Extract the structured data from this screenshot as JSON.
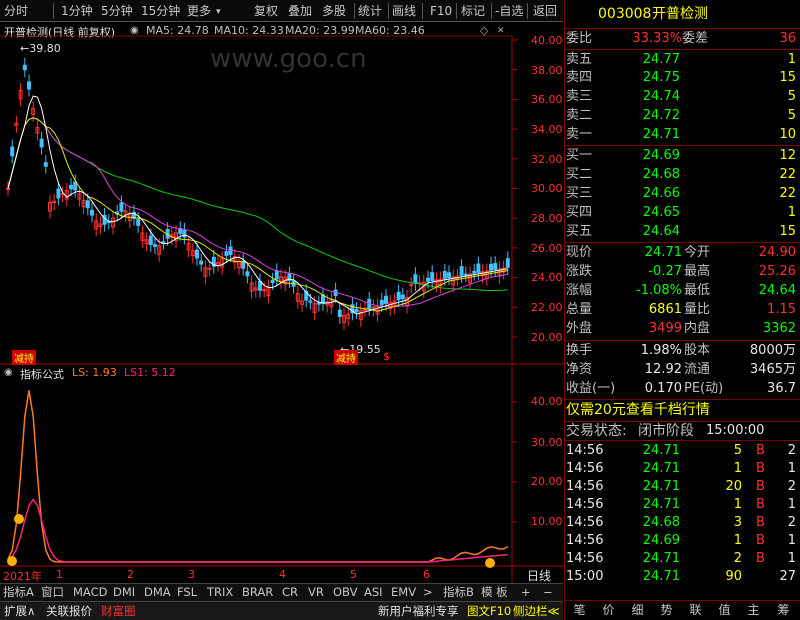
{
  "toolbar": {
    "periods": [
      "分时",
      "1分钟",
      "5分钟",
      "15分钟",
      "更多"
    ],
    "actions": [
      "复权",
      "叠加",
      "多股",
      "统计",
      "画线",
      "F10",
      "标记",
      "-自选",
      "返回"
    ]
  },
  "main": {
    "title": "开普检测(日线 前复权)",
    "ma": [
      {
        "label": "MA5: 24.78",
        "color": "#ffffff"
      },
      {
        "label": "MA10: 24.33",
        "color": "#ffff00"
      },
      {
        "label": "MA20: 23.99",
        "color": "#ff40ff"
      },
      {
        "label": "MA60: 23.46",
        "color": "#00ff00"
      }
    ],
    "y_ticks": [
      "40.00",
      "38.00",
      "36.00",
      "34.00",
      "32.00",
      "30.00",
      "28.00",
      "26.00",
      "24.00",
      "22.00",
      "20.00"
    ],
    "high_label": "39.80",
    "low_label": "19.55",
    "badges": [
      "减持",
      "减持",
      "$"
    ],
    "watermark": "www.goo.cn"
  },
  "indicator": {
    "name": "指标公式",
    "ls": "LS: 1.93",
    "ls1": "LS1: 5.12",
    "y_ticks": [
      "40.00",
      "30.00",
      "20.00",
      "10.00"
    ]
  },
  "timeline": {
    "year": "2021年",
    "months": [
      "1",
      "2",
      "3",
      "4",
      "5",
      "6"
    ],
    "unit": "日线"
  },
  "tabs": [
    "指标A",
    "窗口",
    "MACD",
    "DMI",
    "DMA",
    "FSL",
    "TRIX",
    "BRAR",
    "CR",
    "VR",
    "OBV",
    "ASI",
    "EMV",
    ">",
    "指标B",
    "模 板",
    "+",
    "−"
  ],
  "bottom": {
    "left": [
      "扩展∧",
      "关联报价",
      "财富圈"
    ],
    "right": [
      "新用户福利专享",
      "图文F10",
      "侧边栏≪"
    ]
  },
  "quote": {
    "code": "003008",
    "name": "开普检测",
    "weibi_label": "委比",
    "weibi": "33.33%",
    "weicha_label": "委差",
    "weicha": "36",
    "asks": [
      {
        "label": "卖五",
        "price": "24.77",
        "vol": "1"
      },
      {
        "label": "卖四",
        "price": "24.75",
        "vol": "15"
      },
      {
        "label": "卖三",
        "price": "24.74",
        "vol": "5"
      },
      {
        "label": "卖二",
        "price": "24.72",
        "vol": "5"
      },
      {
        "label": "卖一",
        "price": "24.71",
        "vol": "10"
      }
    ],
    "bids": [
      {
        "label": "买一",
        "price": "24.69",
        "vol": "12"
      },
      {
        "label": "买二",
        "price": "24.68",
        "vol": "22"
      },
      {
        "label": "买三",
        "price": "24.66",
        "vol": "22"
      },
      {
        "label": "买四",
        "price": "24.65",
        "vol": "1"
      },
      {
        "label": "买五",
        "price": "24.64",
        "vol": "15"
      }
    ],
    "stats": [
      {
        "l1": "现价",
        "v1": "24.71",
        "c1": "grn",
        "l2": "今开",
        "v2": "24.90",
        "c2": "red"
      },
      {
        "l1": "涨跌",
        "v1": "-0.27",
        "c1": "grn",
        "l2": "最高",
        "v2": "25.26",
        "c2": "red"
      },
      {
        "l1": "涨幅",
        "v1": "-1.08%",
        "c1": "grn",
        "l2": "最低",
        "v2": "24.64",
        "c2": "grn"
      },
      {
        "l1": "总量",
        "v1": "6861",
        "c1": "yel",
        "l2": "量比",
        "v2": "1.15",
        "c2": "red"
      },
      {
        "l1": "外盘",
        "v1": "3499",
        "c1": "red",
        "l2": "内盘",
        "v2": "3362",
        "c2": "grn"
      }
    ],
    "stats2": [
      {
        "l1": "换手",
        "v1": "1.98%",
        "l2": "股本",
        "v2": "8000万"
      },
      {
        "l1": "净资",
        "v1": "12.92",
        "l2": "流通",
        "v2": "3465万"
      },
      {
        "l1": "收益(一)",
        "v1": "0.170",
        "l2": "PE(动)",
        "v2": "36.7"
      }
    ],
    "promo": "仅需20元查看千档行情",
    "status_label": "交易状态:",
    "status_value": "闭市阶段",
    "status_time": "15:00:00",
    "ticks": [
      {
        "t": "14:56",
        "p": "24.71",
        "v": "5",
        "s": "B",
        "n": "2"
      },
      {
        "t": "14:56",
        "p": "24.71",
        "v": "1",
        "s": "B",
        "n": "1"
      },
      {
        "t": "14:56",
        "p": "24.71",
        "v": "20",
        "s": "B",
        "n": "2"
      },
      {
        "t": "14:56",
        "p": "24.71",
        "v": "1",
        "s": "B",
        "n": "1"
      },
      {
        "t": "14:56",
        "p": "24.68",
        "v": "3",
        "s": "B",
        "n": "2"
      },
      {
        "t": "14:56",
        "p": "24.69",
        "v": "1",
        "s": "B",
        "n": "1"
      },
      {
        "t": "14:56",
        "p": "24.71",
        "v": "2",
        "s": "B",
        "n": "1"
      },
      {
        "t": "15:00",
        "p": "24.71",
        "v": "90",
        "s": "",
        "n": "27"
      }
    ],
    "footer_tabs": [
      "笔",
      "价",
      "细",
      "势",
      "联",
      "值",
      "主",
      "筹"
    ]
  }
}
